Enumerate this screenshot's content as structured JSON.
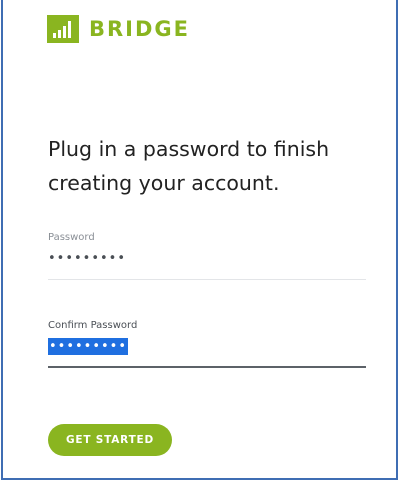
{
  "brand": {
    "name": "BRIDGE",
    "color": "#8ab520",
    "icon": "bars-chart-icon"
  },
  "headline": "Plug in a password to finish creating your account.",
  "form": {
    "password": {
      "label": "Password",
      "value": "•••••••••"
    },
    "confirm_password": {
      "label": "Confirm Password",
      "value": "•••••••••",
      "selected": true
    }
  },
  "submit": {
    "label": "GET STARTED"
  },
  "colors": {
    "frame_border": "#3f6db3",
    "selection": "#1f6fe0",
    "text": "#222222"
  }
}
